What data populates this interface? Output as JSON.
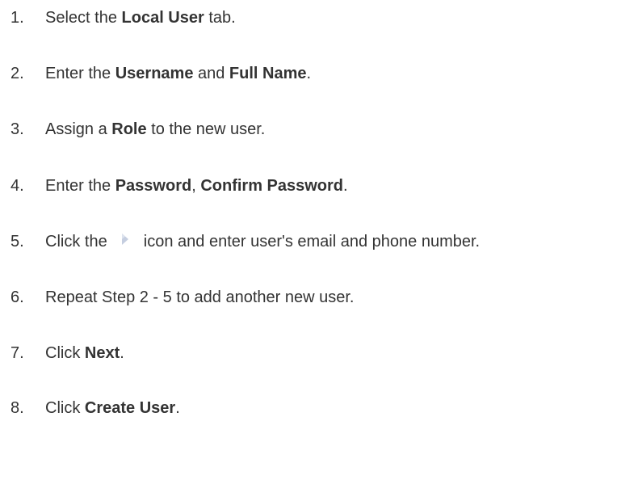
{
  "steps": [
    {
      "number": "1.",
      "pre": "Select the ",
      "b1": "Local User",
      "post": " tab."
    },
    {
      "number": "2.",
      "pre": "Enter the ",
      "b1": "Username",
      "mid": " and ",
      "b2": "Full Name",
      "post": "."
    },
    {
      "number": "3.",
      "pre": "Assign a ",
      "b1": "Role",
      "post": " to the new user."
    },
    {
      "number": "4.",
      "pre": "Enter the ",
      "b1": "Password",
      "mid": ", ",
      "b2": "Confirm Password",
      "post": "."
    },
    {
      "number": "5.",
      "pre": "Click the ",
      "icon": "expand-arrow-icon",
      "post": " icon and enter user's email and phone number."
    },
    {
      "number": "6.",
      "pre": "Repeat Step 2 - 5 to add another new user."
    },
    {
      "number": "7.",
      "pre": "Click ",
      "b1": "Next",
      "post": "."
    },
    {
      "number": "8.",
      "pre": "Click ",
      "b1": "Create User",
      "post": "."
    }
  ],
  "colors": {
    "text": "#333333",
    "icon": "#c5cee0"
  }
}
